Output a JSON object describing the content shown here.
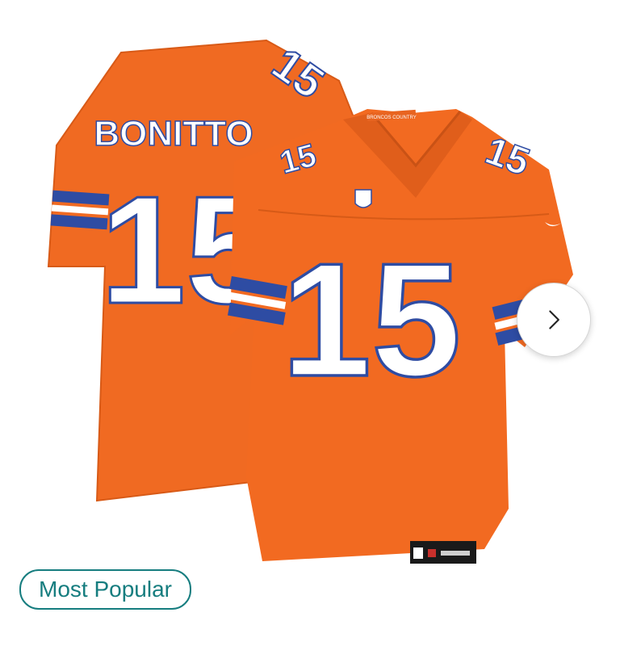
{
  "product": {
    "back_name": "BONITTO",
    "number": "15",
    "collar_tag": "BRONCOS COUNTRY",
    "colors": {
      "jersey": "#F26A21",
      "number_fill": "#FFFFFF",
      "trim": "#2E4CA3"
    }
  },
  "carousel": {
    "next_icon": "chevron-right-icon"
  },
  "badge": {
    "label": "Most Popular",
    "color": "#167D7F"
  }
}
